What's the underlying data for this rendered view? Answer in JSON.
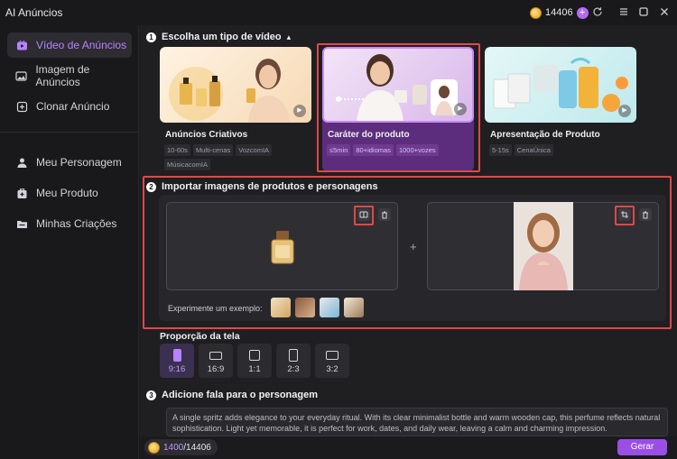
{
  "app": {
    "title": "AI Anúncios",
    "coin_count": "14406",
    "plus_label": "+",
    "window_controls": [
      "refresh-icon",
      "menu-icon",
      "minimize-icon",
      "maximize-icon",
      "close-icon"
    ]
  },
  "sidebar": {
    "items": [
      {
        "label": "Vídeo de Anúncios",
        "icon": "video-icon",
        "active": true
      },
      {
        "label": "Imagem de Anúncios",
        "icon": "image-icon",
        "active": false
      },
      {
        "label": "Clonar Anúncio",
        "icon": "clone-icon",
        "active": false
      },
      {
        "label": "Meu Personagem",
        "icon": "person-icon",
        "active": false
      },
      {
        "label": "Meu Produto",
        "icon": "product-icon",
        "active": false
      },
      {
        "label": "Minhas Criações",
        "icon": "folder-icon",
        "active": false
      }
    ]
  },
  "step1": {
    "number": "1",
    "title": "Escolha um tipo de vídeo",
    "caret": "▴",
    "cards": [
      {
        "title": "Anúncios Criativos",
        "tags": [
          "10-60s",
          "Multi-cenas",
          "VozcomIA",
          "MúsicacomIA"
        ],
        "selected": false
      },
      {
        "title": "Caráter do produto",
        "tags": [
          "≤5min",
          "80+idiomas",
          "1000+vozes"
        ],
        "selected": true
      },
      {
        "title": "Apresentação de Produto",
        "tags": [
          "5-15s",
          "CenaÚnica"
        ],
        "selected": false
      }
    ]
  },
  "step2": {
    "number": "2",
    "title": "Importar imagens de produtos e personagens",
    "plus": "+",
    "examples_label": "Experimente um exemplo:"
  },
  "ratio": {
    "title": "Proporção da tela",
    "options": [
      {
        "label": "9:16",
        "active": true
      },
      {
        "label": "16:9",
        "active": false
      },
      {
        "label": "1:1",
        "active": false
      },
      {
        "label": "2:3",
        "active": false
      },
      {
        "label": "3:2",
        "active": false
      }
    ]
  },
  "step3": {
    "number": "3",
    "title": "Adicione fala para o personagem",
    "speech_text": "A single spritz adds elegance to your everyday ritual. With its clear minimalist bottle and warm wooden cap, this perfume reflects natural sophistication. Light yet memorable, it is perfect for work, dates, and daily wear, leaving a calm and charming impression."
  },
  "footer": {
    "credits_used": "1400",
    "credits_total": "/14406",
    "generate_label": "Gerar"
  },
  "colors": {
    "accent": "#b883ff",
    "selected_card": "#5c2d7d",
    "highlight_box": "#e04848",
    "generate": "#9a4ee6"
  }
}
